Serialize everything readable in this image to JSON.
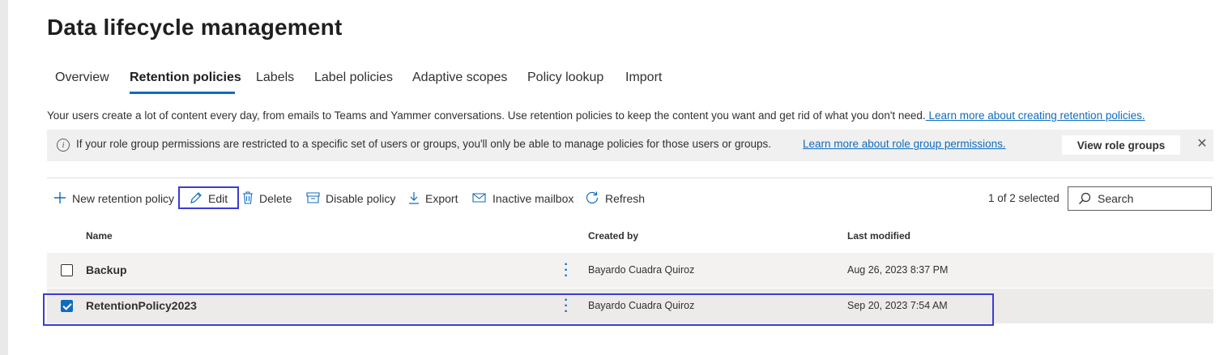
{
  "page": {
    "title": "Data lifecycle management"
  },
  "tabs": [
    {
      "label": "Overview"
    },
    {
      "label": "Retention policies",
      "active": true
    },
    {
      "label": "Labels"
    },
    {
      "label": "Label policies"
    },
    {
      "label": "Adaptive scopes"
    },
    {
      "label": "Policy lookup"
    },
    {
      "label": "Import"
    }
  ],
  "description": {
    "text": "Your users create a lot of content every day, from emails to Teams and Yammer conversations. Use retention policies to keep the content you want and get rid of what you don't need.",
    "link": " Learn more about creating retention policies."
  },
  "info_bar": {
    "icon": "info-icon",
    "text": "If your role group permissions are restricted to a specific set of users or groups, you'll only be able to manage policies for those users or groups.",
    "link": "Learn more about role group permissions.",
    "button": "View role groups",
    "close_icon": "close-icon"
  },
  "toolbar": {
    "new_policy": "New retention policy",
    "edit": "Edit",
    "delete": "Delete",
    "disable_policy": "Disable policy",
    "export": "Export",
    "inactive_mailbox": "Inactive mailbox",
    "refresh": "Refresh",
    "selected_count": "1 of 2 selected",
    "search_placeholder": "Search"
  },
  "table": {
    "columns": [
      "Name",
      "Created by",
      "Last modified"
    ],
    "rows": [
      {
        "name": "Backup",
        "created_by": "Bayardo Cuadra Quiroz",
        "last_modified": "Aug 26, 2023 8:37 PM",
        "checked": false
      },
      {
        "name": "RetentionPolicy2023",
        "created_by": "Bayardo Cuadra Quiroz",
        "last_modified": "Sep 20, 2023 7:54 AM",
        "checked": true
      }
    ]
  },
  "colors": {
    "accent": "#0f6cbd",
    "highlight_box": "#3b3bd6",
    "row_bg": "#f3f2f1",
    "info_bg": "#f0f0f0"
  }
}
